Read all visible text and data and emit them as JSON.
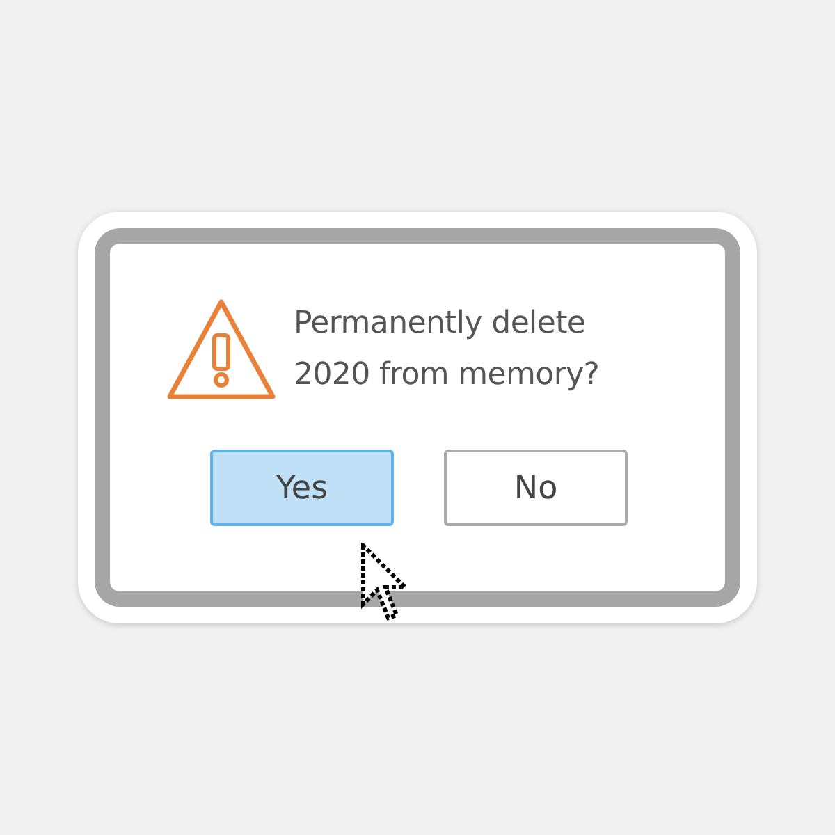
{
  "dialog": {
    "message": "Permanently delete 2020 from memory?",
    "buttons": [
      {
        "label": "Yes",
        "selected": true
      },
      {
        "label": "No",
        "selected": false
      }
    ]
  }
}
